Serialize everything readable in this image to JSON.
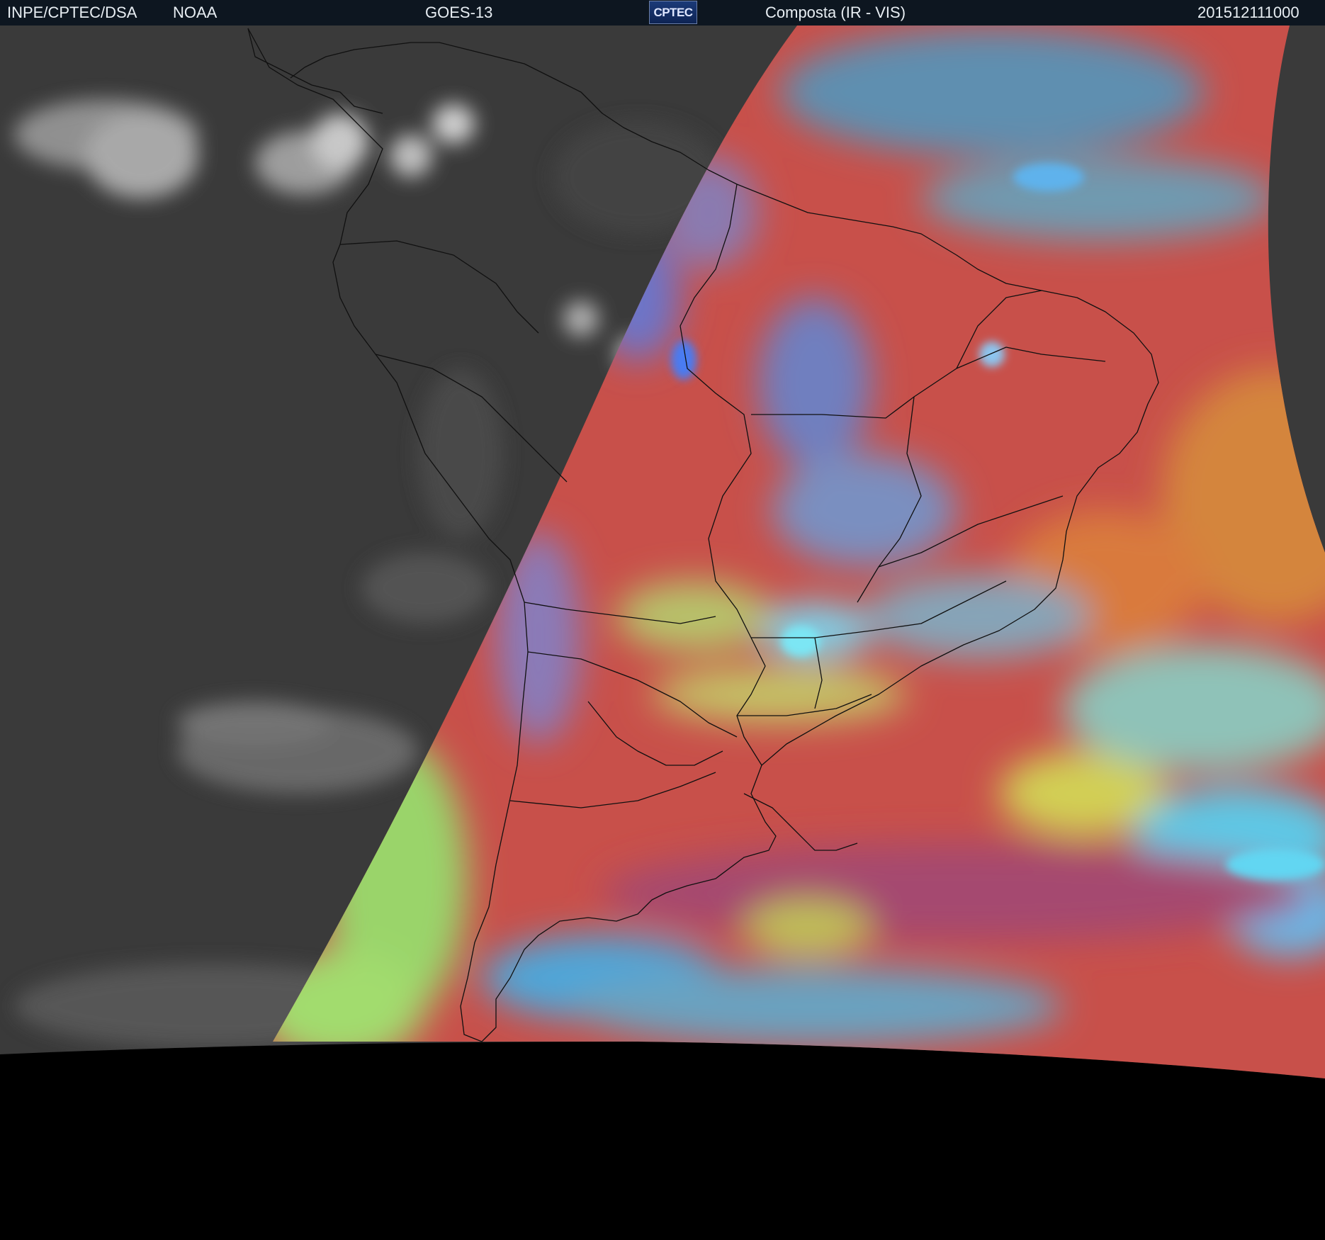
{
  "header": {
    "agency": "INPE/CPTEC/DSA",
    "partner": "NOAA",
    "satellite": "GOES-13",
    "logo_text": "CPTEC",
    "product": "Composta (IR - VIS)",
    "timestamp": "201512111000"
  },
  "colors": {
    "header_bg": "#0d1620",
    "night_gray": "#3a3a3a",
    "ir_red": "#c8504a",
    "space": "#000000"
  }
}
